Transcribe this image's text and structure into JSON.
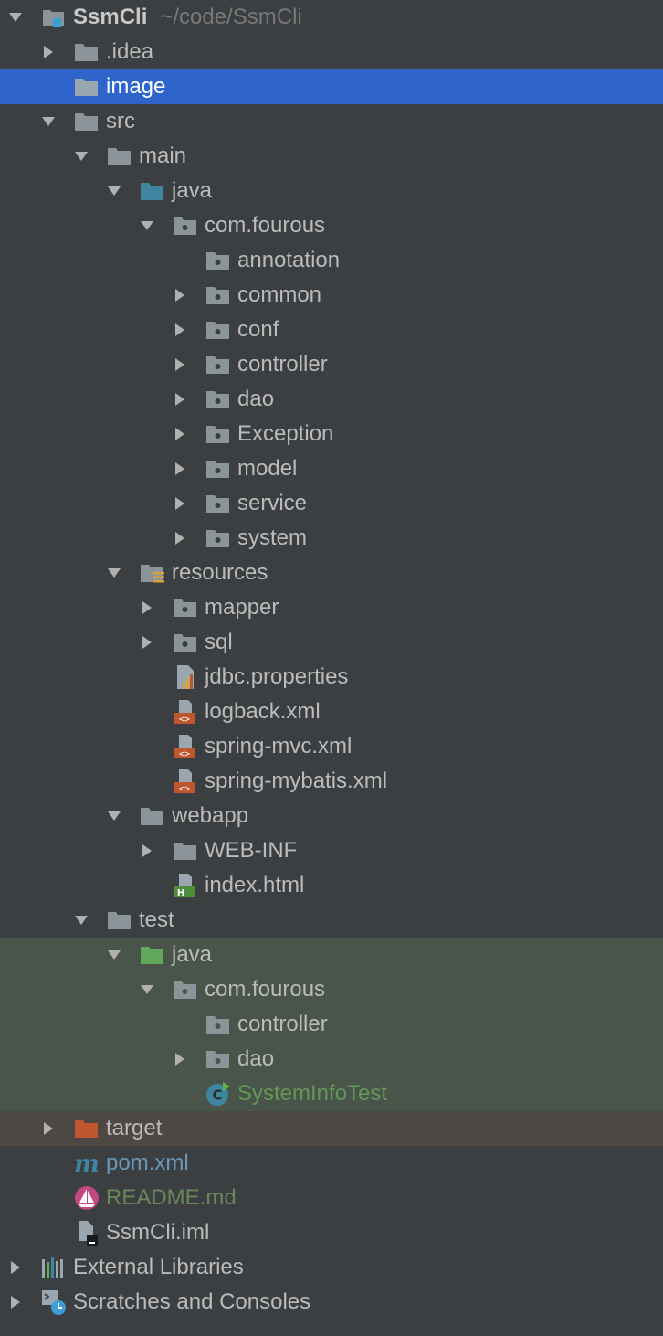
{
  "project": {
    "name": "SsmCli",
    "path": "~/code/SsmCli"
  },
  "items": {
    "idea": ".idea",
    "image": "image",
    "src": "src",
    "main": "main",
    "main_java": "java",
    "pkg_main": "com.fourous",
    "annotation": "annotation",
    "common": "common",
    "conf": "conf",
    "controller": "controller",
    "dao": "dao",
    "exception": "Exception",
    "model": "model",
    "service": "service",
    "system": "system",
    "resources": "resources",
    "mapper": "mapper",
    "sql": "sql",
    "jdbc": "jdbc.properties",
    "logback": "logback.xml",
    "spring_mvc": "spring-mvc.xml",
    "spring_mybatis": "spring-mybatis.xml",
    "webapp": "webapp",
    "webinf": "WEB-INF",
    "index": "index.html",
    "test": "test",
    "test_java": "java",
    "pkg_test": "com.fourous",
    "test_controller": "controller",
    "test_dao": "dao",
    "system_info_test": "SystemInfoTest",
    "target": "target",
    "pom": "pom.xml",
    "readme": "README.md",
    "iml": "SsmCli.iml",
    "external_libraries": "External Libraries",
    "scratches": "Scratches and Consoles"
  },
  "colors": {
    "background": "#3c3f41",
    "selection": "#2f65ca",
    "test_highlight": "#49544a",
    "excluded_highlight": "#4d4844",
    "folder_gray": "#8b9499",
    "source_blue": "#3e86a0",
    "test_green": "#62a85c",
    "excluded_orange": "#c0562d"
  },
  "icons": {
    "module": "module-folder-icon",
    "folder": "folder-icon",
    "source_root": "source-root-folder-icon",
    "test_root": "test-root-folder-icon",
    "package": "package-icon",
    "resources_root": "resources-root-icon",
    "properties": "properties-file-icon",
    "xml": "xml-file-icon",
    "html": "html-file-icon",
    "test_class": "test-class-icon",
    "excluded_folder": "excluded-folder-icon",
    "maven": "maven-icon",
    "markdown": "markdown-icon",
    "iml": "iml-file-icon",
    "libraries": "libraries-icon",
    "scratches": "scratches-icon"
  }
}
